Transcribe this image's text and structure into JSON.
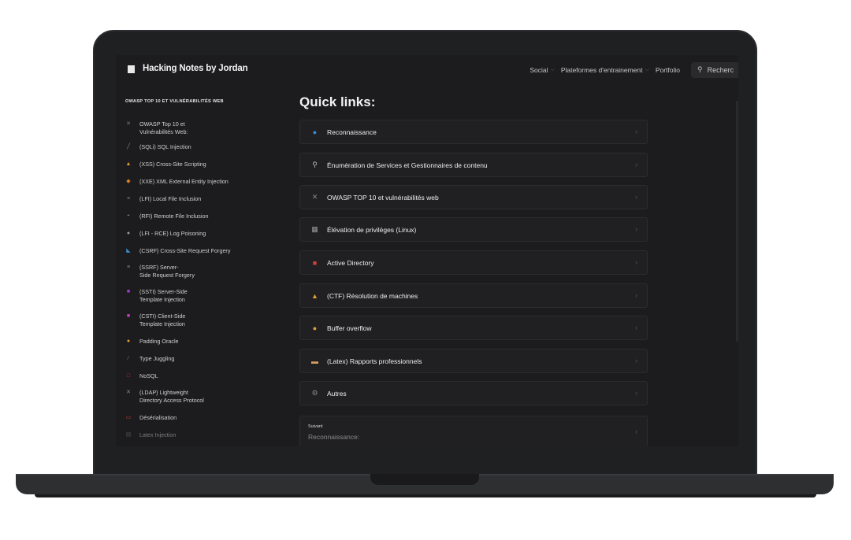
{
  "header": {
    "site_title": "Hacking Notes by Jordan",
    "nav": [
      {
        "label": "Social",
        "has_dropdown": true
      },
      {
        "label": "Plateformes d'entrainement",
        "has_dropdown": true
      },
      {
        "label": "Portfolio",
        "has_dropdown": false
      }
    ],
    "search_placeholder": "Recherc"
  },
  "sidebar": {
    "heading": "OWASP TOP 10 ET VULNÉRABILITÉS WEB",
    "items": [
      {
        "label": "OWASP Top 10 et\nVulnérabilités Web:",
        "icon": "tools-icon",
        "color": "#777777"
      },
      {
        "label": "(SQLi) SQL Injection",
        "icon": "syringe-icon",
        "color": "#8a8a8a"
      },
      {
        "label": "(XSS) Cross-Site Scripting",
        "icon": "warning-icon",
        "color": "#e0a030"
      },
      {
        "label": "(XXE) XML External Entity Injection",
        "icon": "diamond-icon",
        "color": "#e07b20"
      },
      {
        "label": "(LFI) Local File Inclusion",
        "icon": "folder-icon",
        "color": "#7a7a7a"
      },
      {
        "label": "(RFI) Remote File Inclusion",
        "icon": "gamepad-icon",
        "color": "#7a7a7a"
      },
      {
        "label": "(LFI - RCE) Log Poisoning",
        "icon": "chat-icon",
        "color": "#9a9a9a"
      },
      {
        "label": "(CSRF) Cross-Site Request Forgery",
        "icon": "shuffle-icon",
        "color": "#3a8fd0"
      },
      {
        "label": "(SSRF) Server-\nSide Request Forgery",
        "icon": "server-icon",
        "color": "#8a8a8a"
      },
      {
        "label": "(SSTI) Server-Side\nTemplate Injection",
        "icon": "template-icon",
        "color": "#9b3fd0"
      },
      {
        "label": "(CSTI) Client-Side\nTemplate Injection",
        "icon": "template-icon",
        "color": "#c040c0"
      },
      {
        "label": "Padding Oracle",
        "icon": "circle-icon",
        "color": "#e0a030"
      },
      {
        "label": "Type Juggling",
        "icon": "juggle-icon",
        "color": "#7a7a7a"
      },
      {
        "label": "NoSQL",
        "icon": "nosql-icon",
        "color": "#d03030"
      },
      {
        "label": "(LDAP) Lightweight\nDirectory Access Protocol",
        "icon": "network-icon",
        "color": "#8a8a8a"
      },
      {
        "label": "Désérialisation",
        "icon": "box-icon",
        "color": "#c04040"
      },
      {
        "label": "Latex Injection",
        "icon": "doc-icon",
        "color": "#7a7a7a"
      }
    ]
  },
  "main": {
    "title": "Quick links:",
    "links": [
      {
        "label": "Reconnaissance",
        "icon": "globe-icon",
        "color": "#3b8fd6"
      },
      {
        "label": "Énumération de Services et Gestionnaires de contenu",
        "icon": "magnifier-icon",
        "color": "#bbbbbb"
      },
      {
        "label": "OWASP TOP 10 et vulnérabilités web",
        "icon": "tools-icon",
        "color": "#888888"
      },
      {
        "label": "Élévation de privilèges (Linux)",
        "icon": "chart-icon",
        "color": "#9a9a9a"
      },
      {
        "label": "Active Directory",
        "icon": "ad-icon",
        "color": "#d04040"
      },
      {
        "label": "(CTF) Résolution de machines",
        "icon": "warning-icon",
        "color": "#e0a030"
      },
      {
        "label": "Buffer overflow",
        "icon": "burger-icon",
        "color": "#d8a040"
      },
      {
        "label": "(Latex) Rapports professionnels",
        "icon": "hand-icon",
        "color": "#d8a060"
      },
      {
        "label": "Autres",
        "icon": "gear-icon",
        "color": "#888888"
      }
    ],
    "next": {
      "small": "Suivant",
      "label": "Reconnaissance:"
    }
  }
}
